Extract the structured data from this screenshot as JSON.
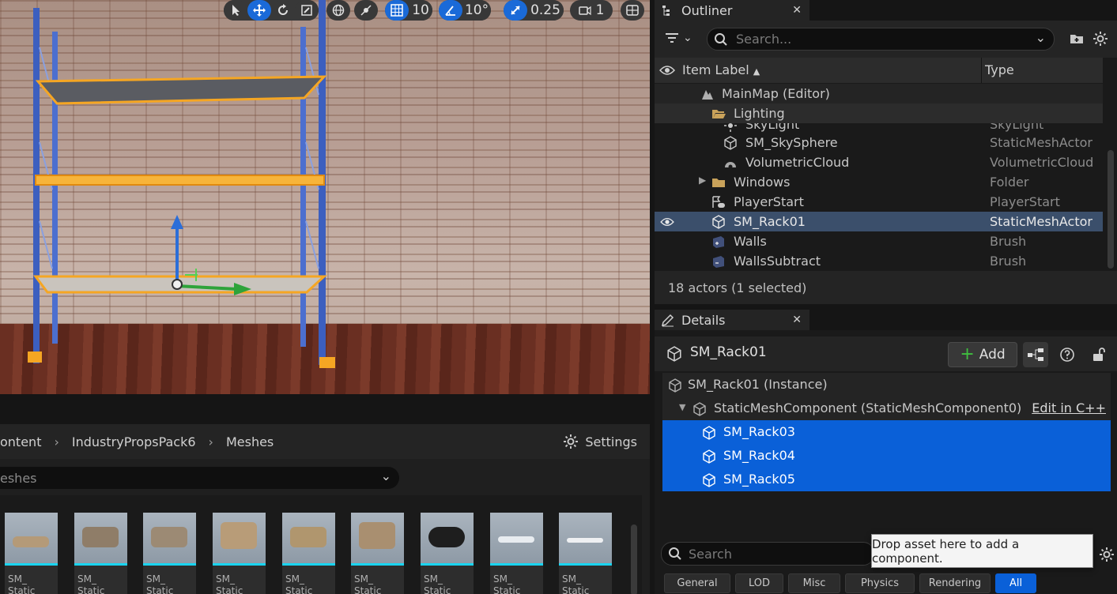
{
  "viewport": {
    "grid_snap": "10",
    "rotation_snap": "10°",
    "scale_snap": "0.25",
    "camera_speed": "1"
  },
  "content_browser": {
    "breadcrumb": [
      "ontent",
      "IndustryPropsPack6",
      "Meshes"
    ],
    "settings_label": "Settings",
    "filter_text": "eshes",
    "assets": [
      {
        "line1": "SM_",
        "line2": "Static Mesh"
      },
      {
        "line1": "SM_",
        "line2": "Static Mesh"
      },
      {
        "line1": "SM_",
        "line2": "Static Mesh"
      },
      {
        "line1": "SM_",
        "line2": "Static Mesh"
      },
      {
        "line1": "SM_",
        "line2": "Static Mesh"
      },
      {
        "line1": "SM_",
        "line2": "Static Mesh"
      },
      {
        "line1": "SM_",
        "line2": "Static Mesh"
      },
      {
        "line1": "SM_",
        "line2": "Static Mesh"
      },
      {
        "line1": "SM_",
        "line2": "Static Mesh"
      }
    ]
  },
  "outliner": {
    "tab_title": "Outliner",
    "search_placeholder": "Search...",
    "col_label": "Item Label",
    "col_type": "Type",
    "rows": [
      {
        "label": "MainMap (Editor)",
        "type": ""
      },
      {
        "label": "Lighting",
        "type": ""
      },
      {
        "label": "SkyLight",
        "type": "SkyLight"
      },
      {
        "label": "SM_SkySphere",
        "type": "StaticMeshActor"
      },
      {
        "label": "VolumetricCloud",
        "type": "VolumetricCloud"
      },
      {
        "label": "Windows",
        "type": "Folder"
      },
      {
        "label": "PlayerStart",
        "type": "PlayerStart"
      },
      {
        "label": "SM_Rack01",
        "type": "StaticMeshActor"
      },
      {
        "label": "Walls",
        "type": "Brush"
      },
      {
        "label": "WallsSubtract",
        "type": "Brush"
      }
    ],
    "footer": "18 actors (1 selected)"
  },
  "details": {
    "tab_title": "Details",
    "actor_name": "SM_Rack01",
    "add_label": "Add",
    "instance_label": "SM_Rack01 (Instance)",
    "component_label": "StaticMeshComponent (StaticMeshComponent0)",
    "edit_link": "Edit in C++",
    "children": [
      "SM_Rack03",
      "SM_Rack04",
      "SM_Rack05"
    ],
    "search_placeholder": "Search",
    "tooltip": "Drop asset here to add a component.",
    "categories": [
      "General",
      "LOD",
      "Misc",
      "Physics",
      "Rendering",
      "All"
    ]
  }
}
